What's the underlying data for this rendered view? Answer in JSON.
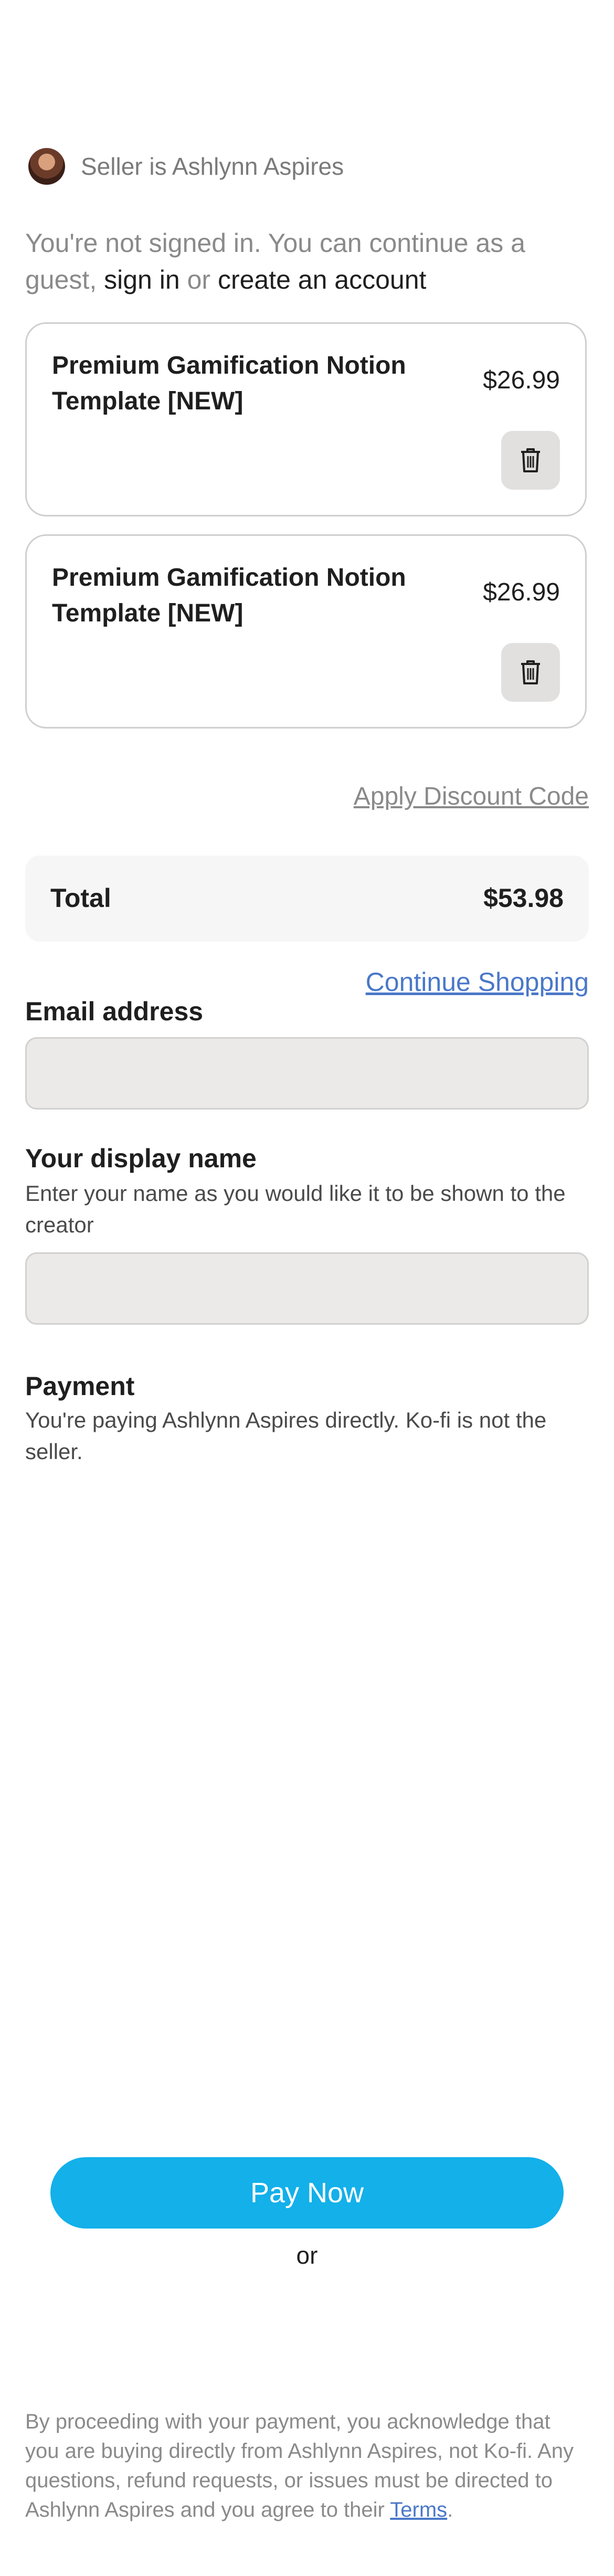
{
  "seller": {
    "text": "Seller is Ashlynn Aspires"
  },
  "signin": {
    "prefix": "You're not signed in. You can continue as a guest,",
    "sign_in": "sign in",
    "or": "or",
    "create": "create an account"
  },
  "cart": {
    "items": [
      {
        "title": "Premium Gamification Notion Template [NEW]",
        "price": "$26.99"
      },
      {
        "title": "Premium Gamification Notion Template [NEW]",
        "price": "$26.99"
      }
    ],
    "discount_label": "Apply Discount Code",
    "total_label": "Total",
    "total_value": "$53.98",
    "continue_label": "Continue Shopping"
  },
  "form": {
    "email_label": "Email address",
    "email_value": "",
    "display_name_label": "Your display name",
    "display_name_help": "Enter your name as you would like it to be shown to the creator",
    "display_name_value": "",
    "payment_label": "Payment",
    "payment_help": "You're paying Ashlynn Aspires directly. Ko-fi is not the seller."
  },
  "pay": {
    "button": "Pay Now",
    "or": "or"
  },
  "footer": {
    "text": "By proceeding with your payment, you acknowledge that you are buying directly from Ashlynn Aspires, not Ko-fi. Any questions, refund requests, or issues must be directed to Ashlynn Aspires and you agree to their",
    "terms": "Terms",
    "end": "."
  },
  "colors": {
    "pay_button": "#13b0ea",
    "link": "#4a78c8"
  }
}
